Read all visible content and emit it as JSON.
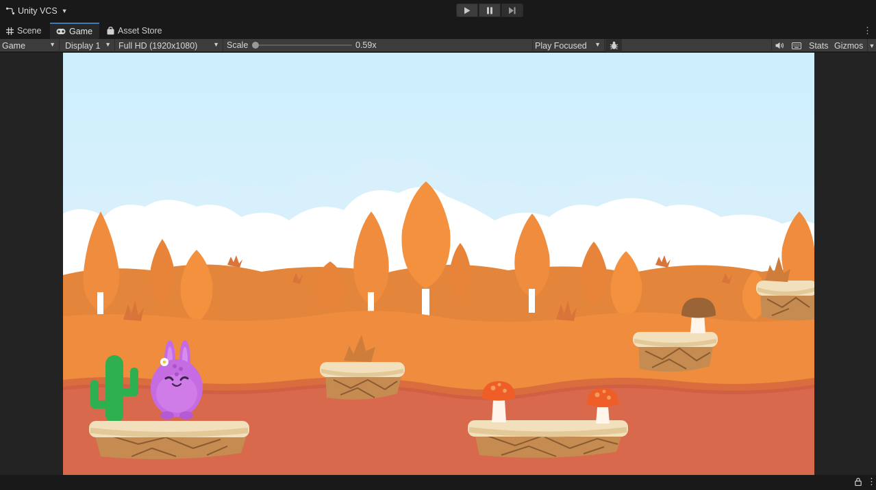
{
  "topbar": {
    "vcs_label": "Unity VCS",
    "play_controls": [
      "play-icon",
      "pause-icon",
      "step-icon"
    ]
  },
  "tabs": [
    {
      "label": "Scene",
      "icon": "grid-icon",
      "active": false
    },
    {
      "label": "Game",
      "icon": "gamepad-icon",
      "active": true
    },
    {
      "label": "Asset Store",
      "icon": "bag-icon",
      "active": false
    }
  ],
  "game_toolbar": {
    "view_mode": "Game",
    "display": "Display 1",
    "resolution": "Full HD (1920x1080)",
    "scale_label": "Scale",
    "scale_value": "0.59x",
    "play_mode": "Play Focused",
    "stats_label": "Stats",
    "gizmos_label": "Gizmos"
  },
  "colors": {
    "accent_tab": "#3a79bb",
    "sky": "#cfeefb",
    "hill_far": "#e6873a",
    "ground_mid": "#f08c3e",
    "ground_near": "#d9694c"
  }
}
